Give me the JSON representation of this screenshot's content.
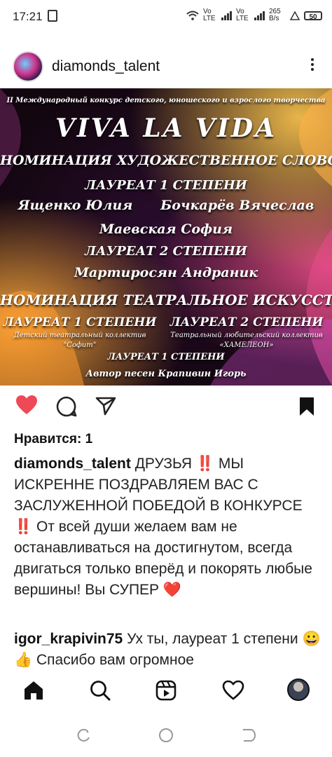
{
  "status_bar": {
    "time": "17:21",
    "net1": "Vo LTE",
    "net2": "Vo LTE",
    "speed": "265 B/s",
    "battery": "50"
  },
  "post": {
    "username": "diamonds_talent",
    "image": {
      "subtitle": "II Международный конкурс детского, юношеского и взрослого творчества",
      "title": "VIVA LA VIDA",
      "nomination1": "НОМИНАЦИЯ ХУДОЖЕСТВЕННОЕ СЛОВО :",
      "laureate1": "ЛАУРЕАТ 1 СТЕПЕНИ",
      "names1": "Ященко Юлия      Бочкарёв Вячеслав",
      "names2": "Маевская София",
      "laureate2": "ЛАУРЕАТ 2 СТЕПЕНИ",
      "names3": "Мартиросян Андраник",
      "nomination2": "НОМИНАЦИЯ ТЕАТРАЛЬНОЕ ИСКУССТВО :",
      "left_heading": "ЛАУРЕАТ 1 СТЕПЕНИ",
      "left_group": "Детский театральный коллектив \"Софит\"",
      "right_heading": "ЛАУРЕАТ 2 СТЕПЕНИ",
      "right_group": "Театральный любительский коллектив «ХАМЕЛЕОН»",
      "laureate3": "ЛАУРЕАТ 1 СТЕПЕНИ",
      "author": "Автор песен Крапивин Игорь"
    },
    "likes": "Нравится: 1",
    "caption_user": "diamonds_talent",
    "caption_text": " ДРУЗЬЯ ‼️ МЫ ИСКРЕННЕ ПОЗДРАВЛЯЕМ ВАС С ЗАСЛУЖЕННОЙ ПОБЕДОЙ В КОНКУРСЕ ‼️ От всей души желаем вам не останавливаться на достигнутом, всегда двигаться только вперёд и покорять любые вершины! Вы СУПЕР ❤️",
    "comment_user": "igor_krapivin75",
    "comment_text": " Ух ты, лауреат 1 степени 😀👍 Спасибо вам огромное"
  },
  "colors": {
    "like": "#ed4956",
    "text": "#111111"
  }
}
